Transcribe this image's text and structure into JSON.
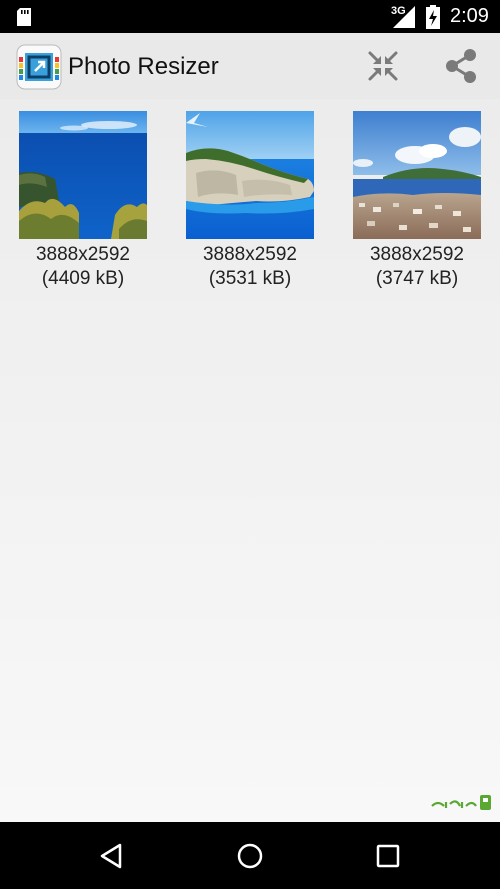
{
  "status_bar": {
    "network_label": "3G",
    "time": "2:09",
    "icons": [
      "sd-card-icon",
      "signal-icon",
      "battery-icon"
    ]
  },
  "app_bar": {
    "title": "Photo Resizer",
    "icons": [
      "app-logo-icon",
      "compress-icon",
      "share-icon"
    ]
  },
  "photos": [
    {
      "dimensions": "3888x2592",
      "size": "(4409 kB)"
    },
    {
      "dimensions": "3888x2592",
      "size": "(3531 kB)"
    },
    {
      "dimensions": "3888x2592",
      "size": "(3747 kB)"
    }
  ],
  "nav_bar": {
    "icons": [
      "back-icon",
      "home-icon",
      "recent-apps-icon"
    ]
  },
  "colors": {
    "status_bar": "#000000",
    "app_bar": "#e9e9e9",
    "background": "#f2f2f2",
    "icon_gray": "#7a7a7a",
    "watermark_green": "#5aa832"
  }
}
